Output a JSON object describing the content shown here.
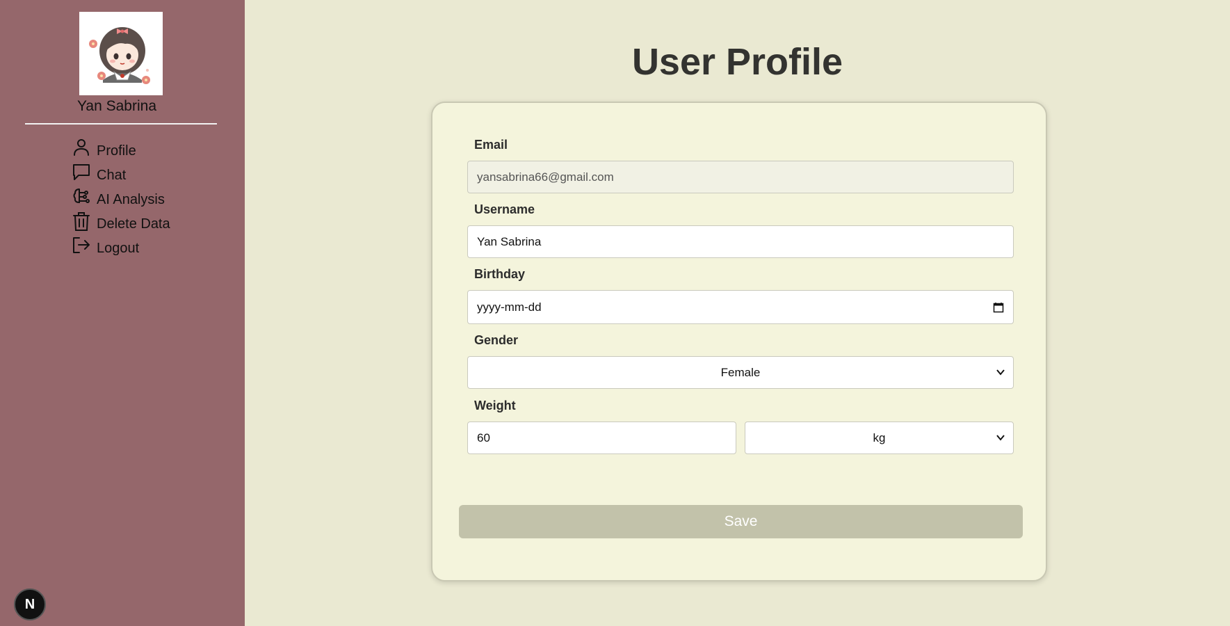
{
  "sidebar": {
    "user_name": "Yan Sabrina",
    "nav": [
      {
        "label": "Profile",
        "icon": "user-icon"
      },
      {
        "label": "Chat",
        "icon": "chat-icon"
      },
      {
        "label": "AI Analysis",
        "icon": "brain-icon"
      },
      {
        "label": "Delete Data",
        "icon": "trash-icon"
      },
      {
        "label": "Logout",
        "icon": "logout-icon"
      }
    ],
    "badge": "N"
  },
  "main": {
    "title": "User Profile",
    "form": {
      "email_label": "Email",
      "email_value": "yansabrina66@gmail.com",
      "username_label": "Username",
      "username_value": "Yan Sabrina",
      "birthday_label": "Birthday",
      "birthday_placeholder": "yyyy-mm-dd",
      "gender_label": "Gender",
      "gender_value": "Female",
      "weight_label": "Weight",
      "weight_value": "60",
      "weight_unit": "kg",
      "save_label": "Save"
    }
  },
  "colors": {
    "sidebar_bg": "#95676b",
    "page_bg": "#eae9d2",
    "card_bg": "#f4f4dc",
    "save_button": "#c2c2aa"
  }
}
